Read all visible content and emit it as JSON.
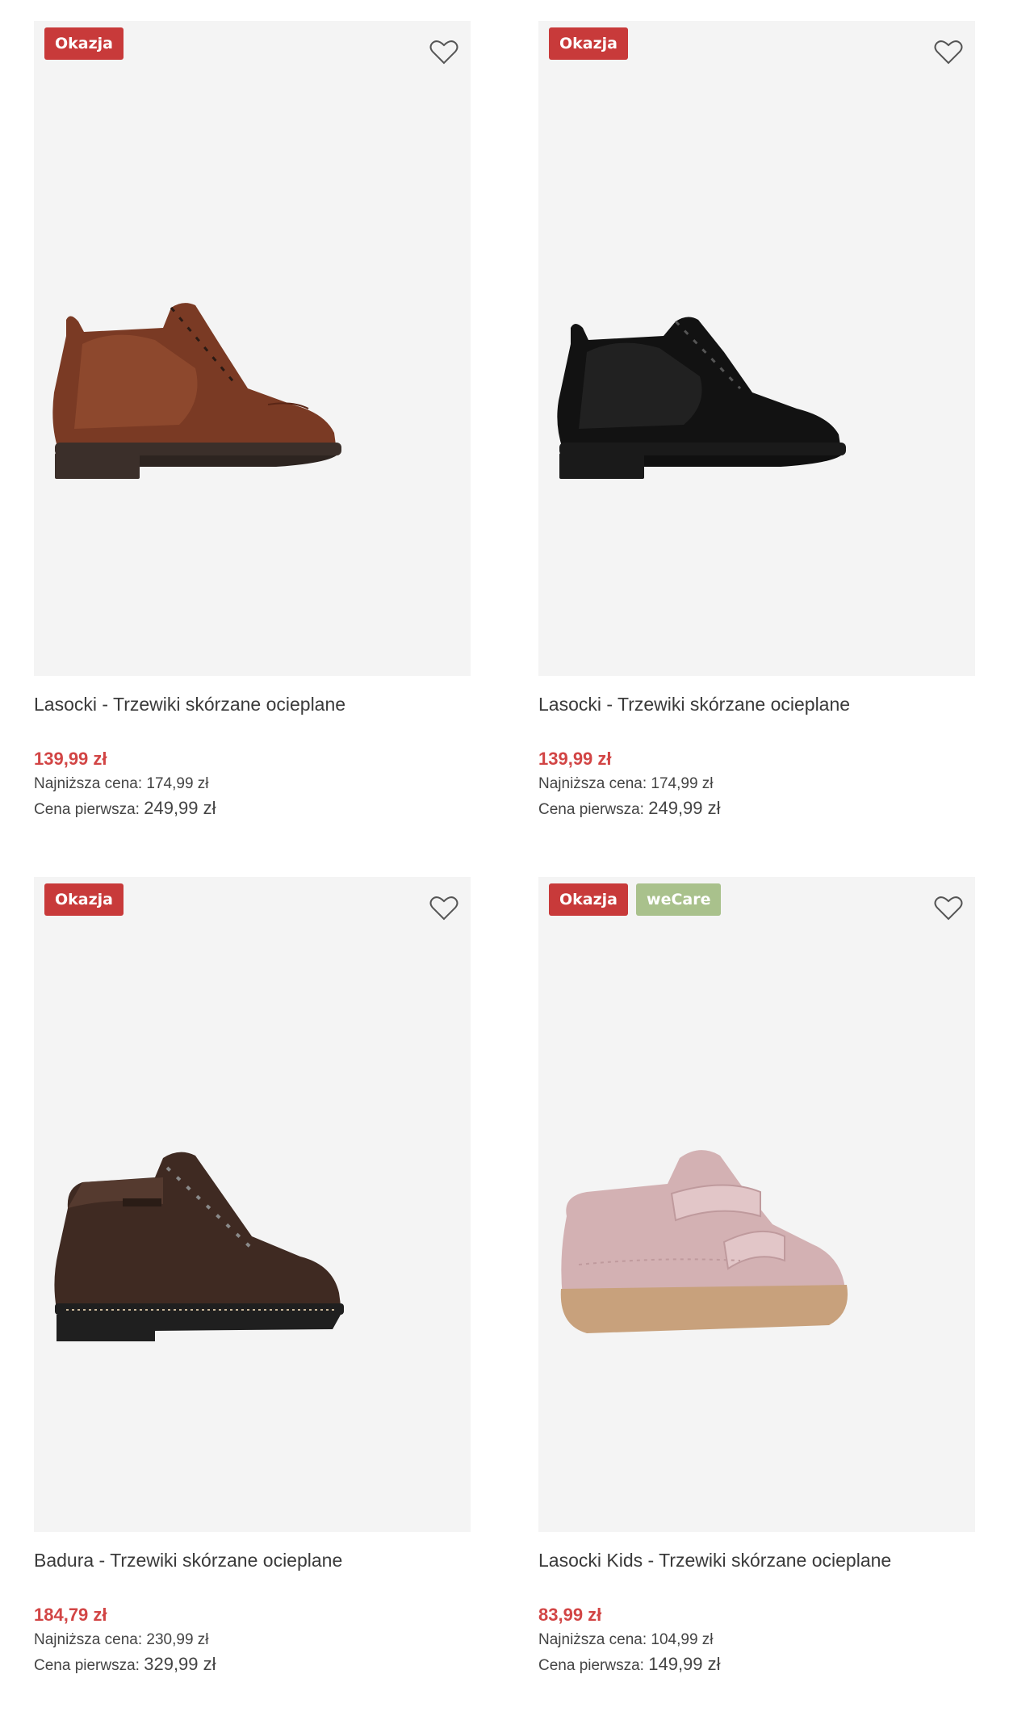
{
  "products": [
    {
      "badges": [
        "Okazja"
      ],
      "title": "Lasocki - Trzewiki skórzane ocieplane",
      "price": "139,99 zł",
      "lowest_label": "Najniższa cena:",
      "lowest_value": "174,99 zł",
      "original_label": "Cena pierwsza:",
      "original_value": "249,99 zł",
      "image": "brown-leather-ankle-boot",
      "colors": {
        "upper": "#7a3a24",
        "upper_light": "#9a5133",
        "sole": "#3b2f2a"
      }
    },
    {
      "badges": [
        "Okazja"
      ],
      "title": "Lasocki - Trzewiki skórzane ocieplane",
      "price": "139,99 zł",
      "lowest_label": "Najniższa cena:",
      "lowest_value": "174,99 zł",
      "original_label": "Cena pierwsza:",
      "original_value": "249,99 zł",
      "image": "black-leather-ankle-boot",
      "colors": {
        "upper": "#121212",
        "upper_light": "#2c2c2c",
        "sole": "#1a1a1a"
      }
    },
    {
      "badges": [
        "Okazja"
      ],
      "title": "Badura - Trzewiki skórzane ocieplane",
      "price": "184,79 zł",
      "lowest_label": "Najniższa cena:",
      "lowest_value": "230,99 zł",
      "original_label": "Cena pierwsza:",
      "original_value": "329,99 zł",
      "image": "dark-brown-hiking-boot",
      "colors": {
        "upper": "#3f2a22",
        "upper_light": "#553a2f",
        "sole": "#1f1f1f"
      }
    },
    {
      "badges": [
        "Okazja",
        "weCare"
      ],
      "title": "Lasocki Kids - Trzewiki skórzane ocieplane",
      "price": "83,99 zł",
      "lowest_label": "Najniższa cena:",
      "lowest_value": "104,99 zł",
      "original_label": "Cena pierwsza:",
      "original_value": "149,99 zł",
      "image": "pink-kids-velcro-boot",
      "colors": {
        "upper": "#d3b1b3",
        "upper_light": "#e2c6c8",
        "sole": "#c8a17c"
      }
    }
  ],
  "icons": {
    "favorite": "heart-outline-icon"
  },
  "accent": {
    "sale": "#c83a3a",
    "wecare": "#a9c18c",
    "price": "#d24545"
  }
}
